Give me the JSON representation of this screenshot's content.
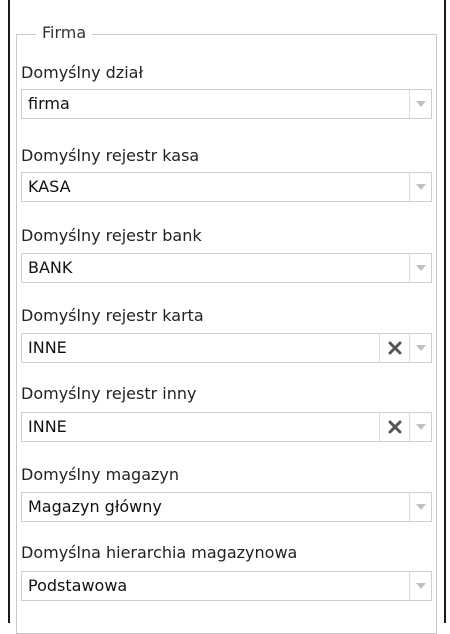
{
  "group": {
    "title": "Firma"
  },
  "fields": [
    {
      "label": "Domyślny dział",
      "value": "firma",
      "clearable": false
    },
    {
      "label": "Domyślny rejestr kasa",
      "value": "KASA",
      "clearable": false
    },
    {
      "label": "Domyślny rejestr bank",
      "value": "BANK",
      "clearable": false
    },
    {
      "label": "Domyślny rejestr karta",
      "value": "INNE",
      "clearable": true
    },
    {
      "label": "Domyślny rejestr inny",
      "value": "INNE",
      "clearable": true
    },
    {
      "label": "Domyślny magazyn",
      "value": "Magazyn główny",
      "clearable": false
    },
    {
      "label": "Domyślna hierarchia magazynowa",
      "value": "Podstawowa",
      "clearable": false
    }
  ],
  "colors": {
    "border": "#cfcfcf",
    "arrow": "#c0c0c0",
    "clear_icon": "#555555"
  }
}
